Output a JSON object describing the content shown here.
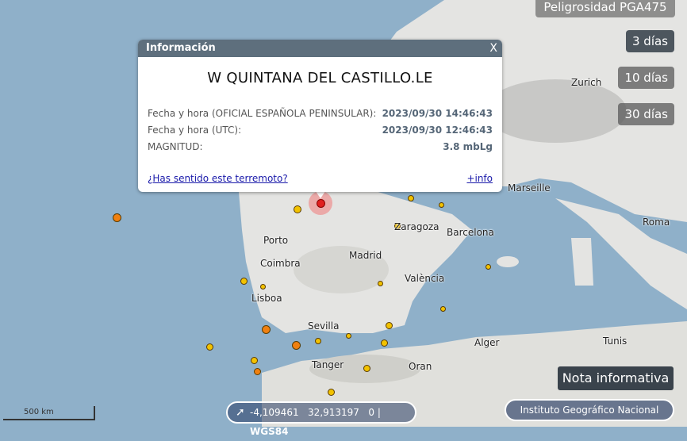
{
  "popup": {
    "header": "Información",
    "close": "X",
    "title": "W QUINTANA DEL CASTILLO.LE",
    "rows": [
      {
        "label": "Fecha y hora (OFICIAL ESPAÑOLA PENINSULAR):",
        "value": "2023/09/30 14:46:43"
      },
      {
        "label": "Fecha y hora (UTC):",
        "value": "2023/09/30 12:46:43"
      },
      {
        "label": "MAGNITUD:",
        "value": "3.8 mbLg"
      }
    ],
    "felt_link": "¿Has sentido este terremoto?",
    "more_link": "+info"
  },
  "controls": {
    "hazard": "Peligrosidad PGA475",
    "days": [
      "3 días",
      "10 días",
      "30 días"
    ],
    "nota": "Nota informativa",
    "ign": "Instituto Geográfico Nacional"
  },
  "coords": {
    "lon": "-4,109461",
    "lat": "32,913197",
    "alt": "0",
    "crs": "WGS84"
  },
  "scale": "500 km",
  "cities": [
    "Zurich",
    "Marseille",
    "Roma",
    "Zaragoza",
    "Barcelona",
    "Porto",
    "Madrid",
    "Coimbra",
    "València",
    "Lisboa",
    "Sevilla",
    "Alger",
    "Tunis",
    "Tanger",
    "Oran"
  ],
  "colors": {
    "sea": "#8fb0c9",
    "land": "#e4e4e2",
    "quake": "#f2c200",
    "quake_old": "#f08010",
    "selected": "#e02020"
  }
}
